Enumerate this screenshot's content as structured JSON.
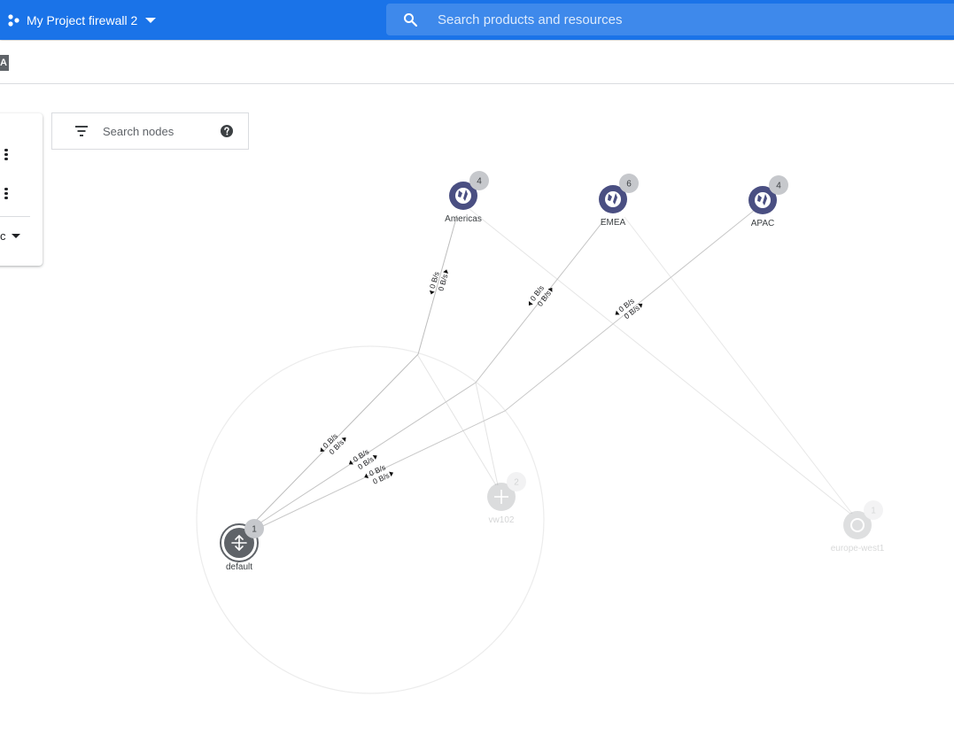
{
  "header": {
    "project_name": "My Project firewall 2",
    "search_placeholder": "Search products and resources"
  },
  "subbar": {
    "badge_text": "A"
  },
  "left_panel": {
    "select_value": "c"
  },
  "node_search": {
    "placeholder": "Search nodes"
  },
  "graph": {
    "nodes": [
      {
        "name": "Americas",
        "count": "4",
        "icon": "globe-icon"
      },
      {
        "name": "EMEA",
        "count": "6",
        "icon": "globe-icon"
      },
      {
        "name": "APAC",
        "count": "4",
        "icon": "globe-icon"
      },
      {
        "name": "default",
        "count": "1",
        "icon": "router-icon"
      },
      {
        "name": "vw102",
        "count": "2",
        "icon": "router-icon"
      },
      {
        "name": "europe-west1",
        "count": "1",
        "icon": "region-icon"
      }
    ],
    "edges": [
      {
        "from": "Americas",
        "to": "default",
        "tx": "0 B/s",
        "rx": "0 B/s"
      },
      {
        "from": "EMEA",
        "to": "default",
        "tx": "0 B/s",
        "rx": "0 B/s"
      },
      {
        "from": "APAC",
        "to": "default",
        "tx": "0 B/s",
        "rx": "0 B/s"
      }
    ],
    "colors": {
      "region_node": "#4a4f82",
      "vpc_node": "#5f6368",
      "count_badge": "#c6c8cc",
      "edge": "#bdbdbd",
      "faded_edge": "#e6e6e6",
      "group_circle": "#ececec"
    }
  }
}
